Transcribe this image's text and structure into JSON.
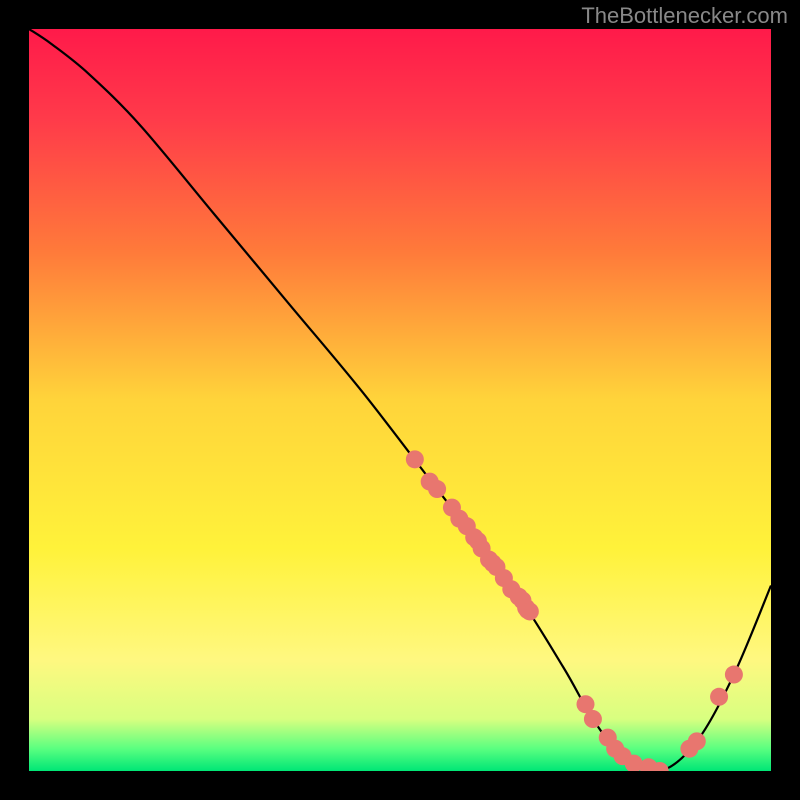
{
  "watermark": "TheBottlenecker.com",
  "chart_data": {
    "type": "line",
    "title": "",
    "xlabel": "",
    "ylabel": "",
    "xlim": [
      0,
      100
    ],
    "ylim": [
      0,
      100
    ],
    "x": [
      0,
      3,
      8,
      15,
      25,
      35,
      45,
      55,
      65,
      72,
      76,
      80,
      85,
      90,
      95,
      100
    ],
    "values": [
      100,
      98,
      94,
      87,
      75,
      63,
      51,
      38,
      25,
      14,
      7,
      2,
      0,
      4,
      13,
      25
    ],
    "markers": {
      "x": [
        52,
        54,
        55,
        57,
        58,
        59,
        60,
        60.5,
        61,
        62,
        62.5,
        63,
        64,
        65,
        66,
        66.5,
        67,
        67.2,
        67.5,
        75,
        76,
        78,
        79,
        80,
        81.5,
        83.5,
        85,
        89,
        90,
        93,
        95
      ],
      "y": [
        42,
        39,
        38,
        35.5,
        34,
        33,
        31.5,
        31,
        30,
        28.5,
        28,
        27.5,
        26,
        24.5,
        23.5,
        23,
        22,
        21.7,
        21.5,
        9,
        7,
        4.5,
        3,
        2,
        1,
        0.5,
        0,
        3,
        4,
        10,
        13
      ]
    },
    "gradient_stops": [
      {
        "offset": 0,
        "color": "#ff1a4a"
      },
      {
        "offset": 0.12,
        "color": "#ff3a4a"
      },
      {
        "offset": 0.3,
        "color": "#ff7a3a"
      },
      {
        "offset": 0.5,
        "color": "#ffd43a"
      },
      {
        "offset": 0.7,
        "color": "#fff23a"
      },
      {
        "offset": 0.85,
        "color": "#fff880"
      },
      {
        "offset": 0.93,
        "color": "#d8ff80"
      },
      {
        "offset": 0.97,
        "color": "#5aff80"
      },
      {
        "offset": 1.0,
        "color": "#00e676"
      }
    ]
  }
}
